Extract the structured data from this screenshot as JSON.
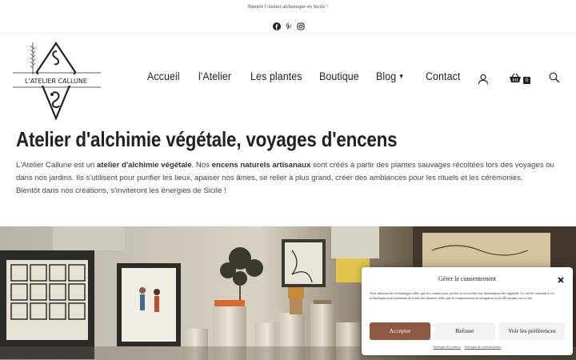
{
  "topbar": {
    "announcement": "Bientôt l'Atelier alchimique en Sicile !"
  },
  "social": [
    "facebook-icon",
    "pinterest-icon",
    "instagram-icon"
  ],
  "logo": {
    "text": "L'ATELIER CALLUNE"
  },
  "nav": {
    "items": [
      {
        "label": "Accueil"
      },
      {
        "label": "l'Atelier"
      },
      {
        "label": "Les plantes"
      },
      {
        "label": "Boutique"
      },
      {
        "label": "Blog"
      },
      {
        "label": "Contact"
      }
    ],
    "cart_count": "0",
    "icons": [
      "user-icon",
      "basket-icon",
      "search-icon"
    ]
  },
  "hero": {
    "title": "Atelier d'alchimie végétale, voyages d'encens",
    "intro_1": "L'Atelier Callune est un ",
    "intro_bold_1": "atelier d'alchimie végétale",
    "intro_2": ". Nos ",
    "intro_bold_2": "encens naturels artisanaux",
    "intro_3": " sont créés à partir des plantes sauvages récoltées lors des voyages ou dans nos jardins. Ils s'utilisent pour purifier les lieux, apaiser nos âmes, se relier à plus grand, créer des ambiances pour les rituels et les cérémonies.",
    "intro_4": "Bientôt dans nos créations, s'inviteront les énergies de Sicile !"
  },
  "consent": {
    "title": "Gérer le consentement",
    "text": "Nous utilisons des technologies telles que les cookies pour stocker et/ou accéder aux informations des appareils. Le fait de consentir à ces technologies nous permettra de traiter des données telles que le comportement de navigation ou les ID uniques sur ce site.",
    "accept": "Accepter",
    "refuse": "Refuser",
    "prefs": "Voir les préférences",
    "link_1": "Politique de cookies",
    "link_2": "Politique de confidentialité"
  },
  "colors": {
    "accent": "#8f5841",
    "text": "#222222"
  }
}
